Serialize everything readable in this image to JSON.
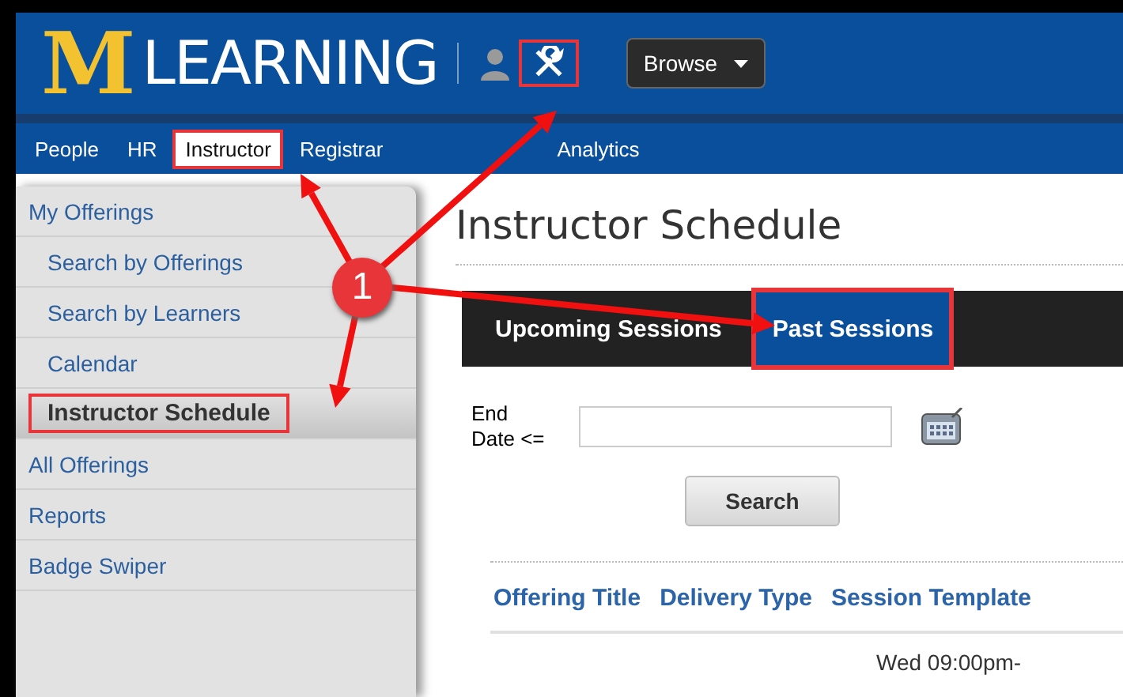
{
  "header": {
    "logo_letter": "M",
    "logo_word": "LEARNING",
    "tools_annotated": true,
    "browse": "Browse"
  },
  "nav": [
    {
      "label": "People",
      "selected": false,
      "annotated": false
    },
    {
      "label": "HR",
      "selected": false,
      "annotated": false
    },
    {
      "label": "Instructor",
      "selected": true,
      "annotated": true
    },
    {
      "label": "Registrar",
      "selected": false,
      "annotated": false
    },
    {
      "label": "Analytics",
      "selected": false,
      "annotated": false
    }
  ],
  "sidebar": {
    "items": [
      {
        "label": "My Offerings",
        "selected": false,
        "annotated": false,
        "children": [
          {
            "label": "Search by Offerings",
            "selected": false,
            "annotated": false
          },
          {
            "label": "Search by Learners",
            "selected": false,
            "annotated": false
          },
          {
            "label": "Calendar",
            "selected": false,
            "annotated": false
          },
          {
            "label": "Instructor Schedule",
            "selected": true,
            "annotated": true
          }
        ]
      },
      {
        "label": "All Offerings",
        "selected": false,
        "annotated": false
      },
      {
        "label": "Reports",
        "selected": false,
        "annotated": false
      },
      {
        "label": "Badge Swiper",
        "selected": false,
        "annotated": false
      }
    ]
  },
  "page_title": "Instructor Schedule",
  "tabs": [
    {
      "label": "Upcoming Sessions",
      "selected": false,
      "annotated": false
    },
    {
      "label": "Past Sessions",
      "selected": true,
      "annotated": true
    }
  ],
  "filter": {
    "label": "End Date <=",
    "button": "Search"
  },
  "table": {
    "columns": [
      "Offering Title",
      "Delivery Type",
      "Session Template"
    ],
    "rows": [
      [
        "",
        "",
        "Wed 09:00pm-"
      ]
    ]
  },
  "callout": {
    "number": "1"
  }
}
